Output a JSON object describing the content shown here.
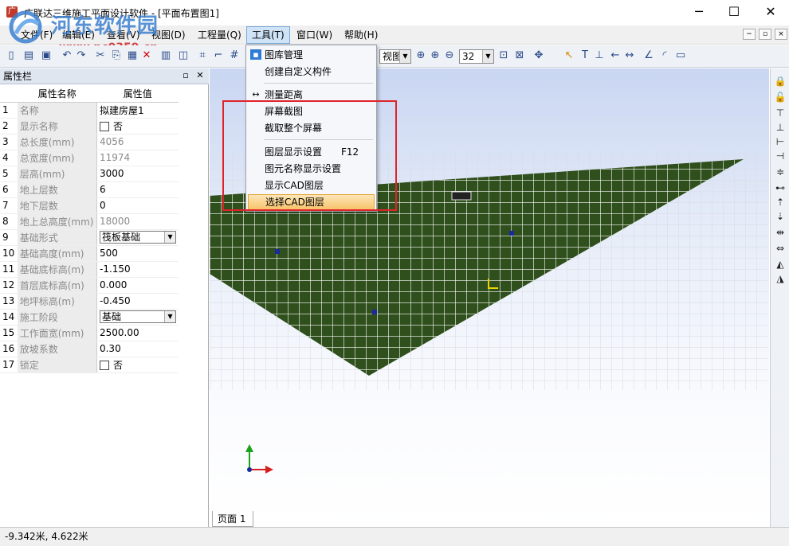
{
  "window": {
    "title": "广联达三维施工平面设计软件 - [平面布置图1]",
    "controls": {
      "minimize": "─",
      "maximize": "☐",
      "close": "✕"
    }
  },
  "watermark": {
    "text": "河东软件园",
    "url": "www.pc0359.cn"
  },
  "menubar": {
    "items": [
      "文件(F)",
      "编辑(E)",
      "查看(V)",
      "视图(D)",
      "工程量(Q)",
      "工具(T)",
      "窗口(W)",
      "帮助(H)"
    ],
    "active": "工具(T)",
    "mdi_controls": [
      "−",
      "▫",
      "×"
    ]
  },
  "toolbar": {
    "view_select": "视图",
    "zoom_select": "32"
  },
  "tools_menu": {
    "items": [
      {
        "label": "图库管理",
        "icon": "library-icon"
      },
      {
        "label": "创建自定义构件",
        "icon": ""
      },
      {
        "label": "测量距离",
        "icon": "ruler-icon"
      },
      {
        "label": "屏幕截图",
        "icon": ""
      },
      {
        "label": "截取整个屏幕",
        "icon": ""
      },
      {
        "label": "图层显示设置",
        "icon": "",
        "shortcut": "F12"
      },
      {
        "label": "图元名称显示设置",
        "icon": ""
      },
      {
        "label": "显示CAD图层",
        "icon": ""
      },
      {
        "label": "选择CAD图层",
        "icon": "",
        "highlighted": true
      }
    ]
  },
  "properties_panel": {
    "title": "属性栏",
    "pin": "▫",
    "close": "✕",
    "col_name": "属性名称",
    "col_value": "属性值",
    "rows": [
      {
        "idx": "1",
        "name": "名称",
        "value": "拟建房屋1"
      },
      {
        "idx": "2",
        "name": "显示名称",
        "value": "否",
        "checkbox": true
      },
      {
        "idx": "3",
        "name": "总长度(mm)",
        "value": "4056",
        "readonly": true
      },
      {
        "idx": "4",
        "name": "总宽度(mm)",
        "value": "11974",
        "readonly": true
      },
      {
        "idx": "5",
        "name": "层高(mm)",
        "value": "3000"
      },
      {
        "idx": "6",
        "name": "地上层数",
        "value": "6"
      },
      {
        "idx": "7",
        "name": "地下层数",
        "value": "0"
      },
      {
        "idx": "8",
        "name": "地上总高度(mm)",
        "value": "18000",
        "readonly": true
      },
      {
        "idx": "9",
        "name": "基础形式",
        "value": "筏板基础",
        "dropdown": true
      },
      {
        "idx": "10",
        "name": "基础高度(mm)",
        "value": "500"
      },
      {
        "idx": "11",
        "name": "基础底标高(m)",
        "value": "-1.150"
      },
      {
        "idx": "12",
        "name": "首层底标高(m)",
        "value": "0.000"
      },
      {
        "idx": "13",
        "name": "地坪标高(m)",
        "value": "-0.450"
      },
      {
        "idx": "14",
        "name": "施工阶段",
        "value": "基础",
        "dropdown": true
      },
      {
        "idx": "15",
        "name": "工作面宽(mm)",
        "value": "2500.00"
      },
      {
        "idx": "16",
        "name": "放坡系数",
        "value": "0.30"
      },
      {
        "idx": "17",
        "name": "锁定",
        "value": "否",
        "checkbox": true
      }
    ]
  },
  "canvas": {
    "page_tab": "页面 1",
    "terrain_color": "#2f4f1c",
    "grid_color": "#ffffff"
  },
  "status": {
    "coords": "-9.342米, 4.622米"
  },
  "colors": {
    "highlight_box": "#e0232a",
    "menu_highlight": "#f7c36b"
  }
}
